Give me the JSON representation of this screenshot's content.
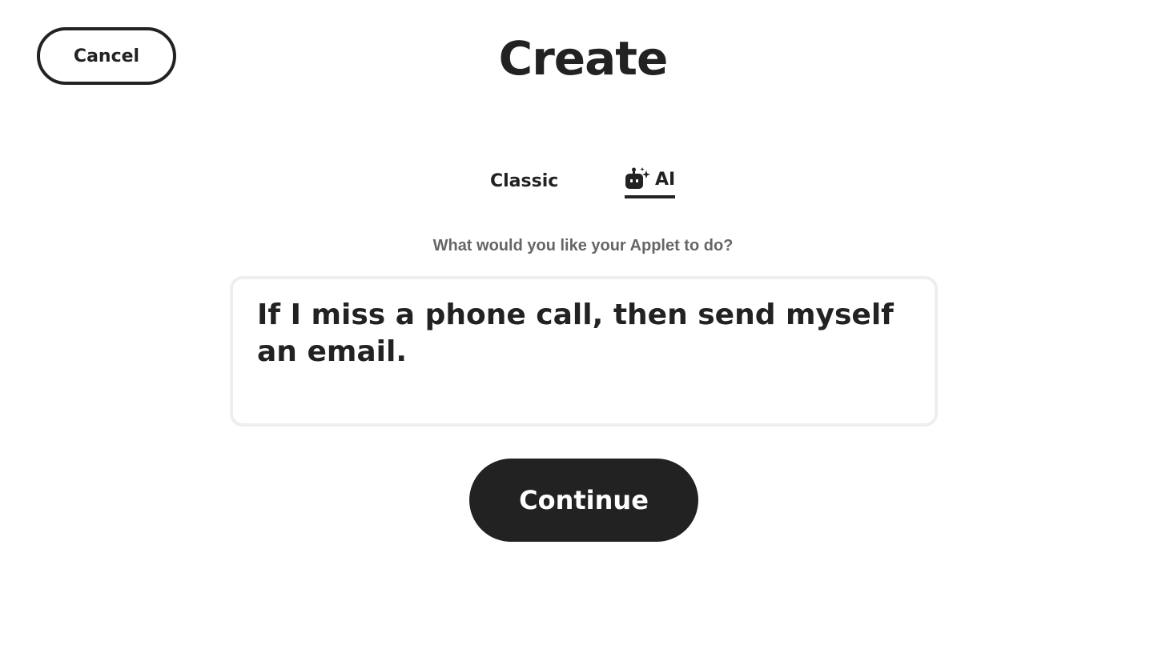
{
  "header": {
    "cancel_label": "Cancel",
    "title": "Create"
  },
  "tabs": [
    {
      "label": "Classic",
      "active": false
    },
    {
      "label": "AI",
      "active": true,
      "icon": "robot-sparkle-icon"
    }
  ],
  "prompt": {
    "label": "What would you like your Applet to do?",
    "value": "If I miss a phone call, then send myself an email."
  },
  "actions": {
    "continue_label": "Continue"
  },
  "colors": {
    "text": "#222222",
    "muted_text": "#666666",
    "border_light": "#eeeeee",
    "button_bg": "#222222",
    "button_text": "#ffffff",
    "background": "#ffffff"
  }
}
